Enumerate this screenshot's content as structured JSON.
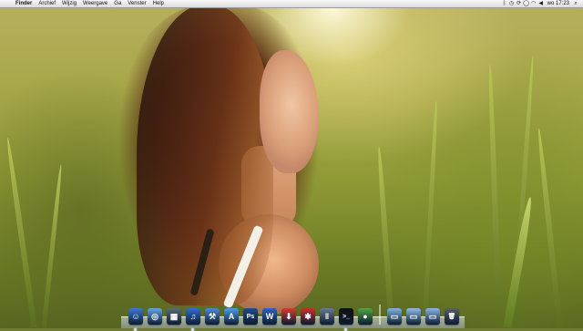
{
  "menubar": {
    "apple_icon": "apple-logo",
    "items": [
      "Finder",
      "Archief",
      "Wijzig",
      "Weergave",
      "Ga",
      "Venster",
      "Help"
    ],
    "status_icons": [
      "bluetooth-icon",
      "time-machine-icon",
      "sync-icon",
      "chat-icon",
      "wifi-icon",
      "volume-icon"
    ],
    "clock": "wo 17:23",
    "spotlight_icon": "search-icon"
  },
  "dock": {
    "apps": [
      {
        "name": "finder",
        "color": "#3a7bd5",
        "glyph": "☺"
      },
      {
        "name": "safari",
        "color": "#5fa8e8",
        "glyph": "◎"
      },
      {
        "name": "preview",
        "color": "#5b6b7e",
        "glyph": "▦"
      },
      {
        "name": "itunes",
        "color": "#2f6fd1",
        "glyph": "♫"
      },
      {
        "name": "xcode",
        "color": "#4b8ad6",
        "glyph": "⚒"
      },
      {
        "name": "app-store",
        "color": "#4aa0ea",
        "glyph": "A"
      },
      {
        "name": "photoshop",
        "color": "#1c4d8c",
        "glyph": "Ps"
      },
      {
        "name": "word",
        "color": "#2b63c7",
        "glyph": "W"
      },
      {
        "name": "flashget",
        "color": "#d63a2e",
        "glyph": "⬇"
      },
      {
        "name": "crossover",
        "color": "#c9302c",
        "glyph": "✱"
      },
      {
        "name": "parallels",
        "color": "#6a7c8e",
        "glyph": "‖"
      },
      {
        "name": "terminal",
        "color": "#111111",
        "glyph": ">_"
      },
      {
        "name": "adium",
        "color": "#4ea844",
        "glyph": "●"
      }
    ],
    "stacks": [
      {
        "name": "applications-folder",
        "color": "#7fb4e6",
        "glyph": "▭"
      },
      {
        "name": "documents-folder",
        "color": "#8fbde8",
        "glyph": "▭"
      },
      {
        "name": "downloads-folder",
        "color": "#88b8e6",
        "glyph": "▭"
      },
      {
        "name": "trash",
        "color": "#5c5f63",
        "glyph": "🗑"
      }
    ]
  }
}
